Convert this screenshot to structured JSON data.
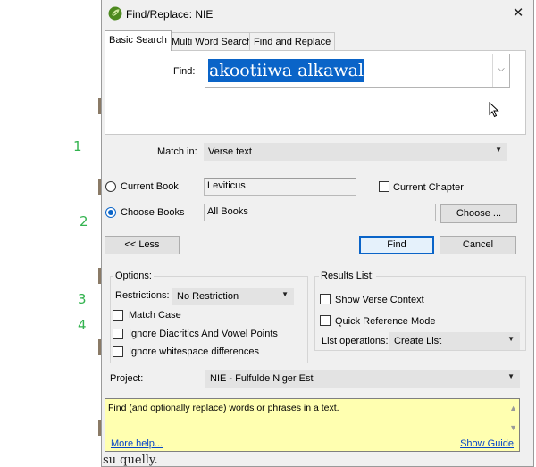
{
  "window": {
    "title": "Find/Replace: NIE",
    "close_glyph": "✕"
  },
  "tabs": [
    {
      "label": "Basic Search",
      "active": true
    },
    {
      "label": "Multi Word Search",
      "active": false
    },
    {
      "label": "Find and Replace",
      "active": false
    }
  ],
  "find": {
    "label": "Find:",
    "value": "akootiiwa alkawal",
    "dropdown_glyph": "⌵"
  },
  "match_in": {
    "label": "Match in:",
    "value": "Verse text"
  },
  "scope": {
    "current_book_label": "Current Book",
    "current_book_value": "Leviticus",
    "current_chapter_label": "Current Chapter",
    "choose_books_label": "Choose Books",
    "choose_books_value": "All Books",
    "choose_button": "Choose ...",
    "selected": "choose_books"
  },
  "buttons": {
    "less": "<< Less",
    "find": "Find",
    "cancel": "Cancel"
  },
  "options": {
    "title": "Options:",
    "restrictions_label": "Restrictions:",
    "restrictions_value": "No Restriction",
    "match_case": "Match Case",
    "ignore_diacritics": "Ignore Diacritics And Vowel Points",
    "ignore_whitespace": "Ignore whitespace differences"
  },
  "results": {
    "title": "Results List:",
    "show_verse_context": "Show Verse Context",
    "quick_reference_mode": "Quick Reference Mode",
    "list_operations_label": "List operations:",
    "list_operations_value": "Create List"
  },
  "project": {
    "label": "Project:",
    "value": "NIE -  Fulfulde Niger Est"
  },
  "help": {
    "text": "Find (and optionally replace) words or phrases in a text.",
    "more_help": "More help...",
    "show_guide": "Show Guide"
  },
  "annotations": [
    "1",
    "2",
    "3",
    "4"
  ],
  "background_text": "su quelly.",
  "colors": {
    "accent": "#0a64c8",
    "selection": "#0a64c8",
    "help_background": "#ffffb0",
    "annotation": "#33b34f",
    "link": "#0645c8"
  }
}
